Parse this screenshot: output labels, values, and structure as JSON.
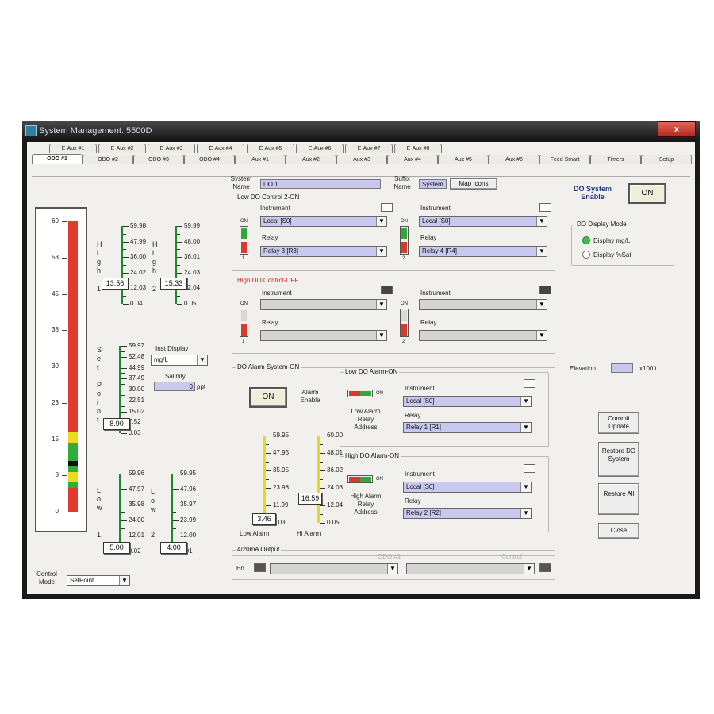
{
  "window": {
    "title": "System Management: 5500D",
    "close": "x"
  },
  "tabs_row1": [
    "E-Aux #1",
    "E-Aux #2",
    "E-Aux #3",
    "E-Aux #4",
    "E-Aux #5",
    "E-Aux #6",
    "E-Aux #7",
    "E-Aux #8"
  ],
  "tabs_row2": [
    "ODO #1",
    "ODO #2",
    "ODO #3",
    "ODO #4",
    "Aux #1",
    "Aux #2",
    "Aux #3",
    "Aux #4",
    "Aux #5",
    "Aux #6",
    "Feed Smart",
    "Timers",
    "Setup"
  ],
  "big_bar": {
    "ticks": [
      "60",
      "53",
      "45",
      "38",
      "30",
      "23",
      "15",
      "8",
      "0"
    ]
  },
  "high1": {
    "letters": [
      "H",
      "i",
      "g",
      "h"
    ],
    "num": "1",
    "scale": [
      "59.98",
      "47.99",
      "36.00",
      "24.02",
      "12.03",
      "0.04"
    ],
    "value": "13.56"
  },
  "high2": {
    "letters": [
      "H",
      "i",
      "g",
      "h"
    ],
    "num": "2",
    "scale": [
      "59.99",
      "48.00",
      "36.01",
      "24.03",
      "12.04",
      "0.05"
    ],
    "value": "15.33"
  },
  "setpoint": {
    "letters": [
      "S",
      "e",
      "t",
      "",
      "P",
      "o",
      "i",
      "n",
      "t"
    ],
    "scale": [
      "59.97",
      "52.48",
      "44.99",
      "37.49",
      "30.00",
      "22.51",
      "15.02",
      "7.52",
      "0.03"
    ],
    "value": "8.90"
  },
  "low1": {
    "letters": [
      "L",
      "o",
      "w"
    ],
    "num": "1",
    "scale": [
      "59.96",
      "47.97",
      "35.98",
      "24.00",
      "12.01",
      "0.02"
    ],
    "value": "5.00"
  },
  "low2": {
    "letters": [
      "L",
      "o",
      "w"
    ],
    "num": "2",
    "scale": [
      "59.95",
      "47.96",
      "35.97",
      "23.99",
      "12.00",
      "0.01"
    ],
    "value": "4.00"
  },
  "inst_display": {
    "label": "Inst Display",
    "value": "mg/L"
  },
  "salinity": {
    "label": "Salinity",
    "value": "0",
    "unit": "ppt"
  },
  "control_mode": {
    "label": "Control Mode",
    "value": "SetPoint"
  },
  "system_name": {
    "label": "System Name",
    "value": "DO 1"
  },
  "suffix_name": {
    "label": "Suffix Name",
    "value": "System"
  },
  "map_icons_button": "Map Icons",
  "low_do": {
    "title": "Low DO Control 2-ON",
    "left": {
      "on": "ON",
      "num": "1",
      "instrument_label": "Instrument",
      "instrument": "Local [S0]",
      "relay_label": "Relay",
      "relay": "Relay 3 [R3]"
    },
    "right": {
      "on": "ON",
      "num": "2",
      "instrument_label": "Instrument",
      "instrument": "Local [S0]",
      "relay_label": "Relay",
      "relay": "Relay 4 [R4]"
    }
  },
  "high_do": {
    "title": "High DO Control-OFF",
    "left": {
      "on": "ON",
      "num": "1",
      "instrument_label": "Instrument",
      "relay_label": "Relay"
    },
    "right": {
      "on": "ON",
      "num": "2",
      "instrument_label": "Instrument",
      "relay_label": "Relay"
    }
  },
  "alarm_system": {
    "title": "DO Alarm System-ON",
    "on_button": "ON",
    "alarm_enable": "Alarm Enable",
    "low_scale": [
      "59.95",
      "47.95",
      "35.95",
      "23.98",
      "11.99",
      "0.03"
    ],
    "low_value": "3.46",
    "low_label": "Low Alarm",
    "hi_scale": [
      "60.00",
      "48.01",
      "36.02",
      "24.03",
      "12.04",
      "0.05"
    ],
    "hi_value": "16.59",
    "hi_label": "Hi Alarm",
    "low_alarm": {
      "title": "Low DO Alarm-ON",
      "on": "ON",
      "instrument_label": "Instrument",
      "instrument": "Local [S0]",
      "relay_label": "Relay",
      "relay": "Relay 1 [R1]",
      "side": "Low Alarm Relay Address"
    },
    "high_alarm": {
      "title": "High DO Alarm-ON",
      "on": "ON",
      "instrument_label": "Instrument",
      "instrument": "Local [S0]",
      "relay_label": "Relay",
      "relay": "Relay 2 [R2]",
      "side": "High Alarm Relay Address"
    }
  },
  "output": {
    "title": "4/20mA Output",
    "en": "En",
    "label1": "ODO #1",
    "label2": "Control"
  },
  "do_system": {
    "label": "DO System Enable",
    "button": "ON"
  },
  "display_mode": {
    "title": "DO Display Mode",
    "opt1": "Display mg/L",
    "opt2": "Display %Sat"
  },
  "elevation": {
    "label": "Elevation",
    "unit": "x100ft"
  },
  "buttons": {
    "commit": "Commit Update",
    "restore_do": "Restore DO System",
    "restore_all": "Restore All",
    "close": "Close"
  },
  "colors": {
    "bar_red": "#e03a2e",
    "bar_green": "#2fae3a",
    "bar_yellow": "#ecdc1e",
    "field": "#c9c9ef"
  }
}
